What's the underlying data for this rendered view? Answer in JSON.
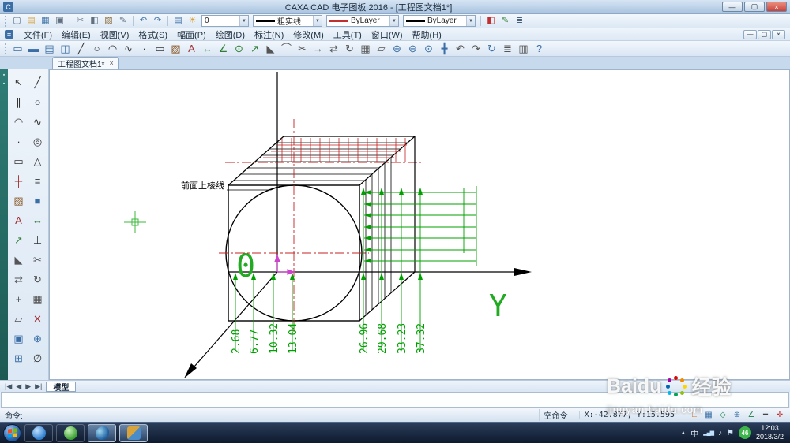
{
  "window": {
    "title": "CAXA CAD 电子图板 2016 - [工程图文档1*]",
    "controls": {
      "min": "—",
      "max": "▢",
      "close": "×"
    }
  },
  "menu": [
    {
      "name": "menu-file",
      "label": "文件(F)"
    },
    {
      "name": "menu-edit",
      "label": "编辑(E)"
    },
    {
      "name": "menu-view",
      "label": "视图(V)"
    },
    {
      "name": "menu-format",
      "label": "格式(S)"
    },
    {
      "name": "menu-sheet",
      "label": "幅面(P)"
    },
    {
      "name": "menu-draw",
      "label": "绘图(D)"
    },
    {
      "name": "menu-dimension",
      "label": "标注(N)"
    },
    {
      "name": "menu-modify",
      "label": "修改(M)"
    },
    {
      "name": "menu-tools",
      "label": "工具(T)"
    },
    {
      "name": "menu-window",
      "label": "窗口(W)"
    },
    {
      "name": "menu-help",
      "label": "帮助(H)"
    }
  ],
  "toolbars": {
    "std1": [
      {
        "name": "new-icon",
        "glyph": "▢",
        "color": "#55708c"
      },
      {
        "name": "open-icon",
        "glyph": "▤",
        "color": "#d9a33c"
      },
      {
        "name": "save-icon",
        "glyph": "▦",
        "color": "#3a6ea5"
      },
      {
        "name": "print-icon",
        "glyph": "▣",
        "color": "#607080"
      }
    ],
    "std2": [
      {
        "name": "cut-icon",
        "glyph": "✂",
        "color": "#607080"
      },
      {
        "name": "copy-icon",
        "glyph": "◧",
        "color": "#607080"
      },
      {
        "name": "paste-icon",
        "glyph": "▨",
        "color": "#8a6d3b"
      },
      {
        "name": "format-painter-icon",
        "glyph": "✎",
        "color": "#607080"
      }
    ],
    "std3": [
      {
        "name": "undo-icon",
        "glyph": "↶",
        "color": "#3a6ea5"
      },
      {
        "name": "redo-icon",
        "glyph": "↷",
        "color": "#3a6ea5"
      }
    ],
    "layer_pre": [
      {
        "name": "layer-manager-icon",
        "glyph": "▤",
        "color": "#3a6ea5"
      },
      {
        "name": "layer-state-icon",
        "glyph": "☀",
        "color": "#d9a33c"
      }
    ],
    "std4": [
      {
        "name": "color-palette-icon",
        "glyph": "◧",
        "color": "#c03030"
      },
      {
        "name": "match-properties-icon",
        "glyph": "✎",
        "color": "#2e7d32"
      },
      {
        "name": "options-menu-icon",
        "glyph": "≣",
        "color": "#49607a"
      }
    ],
    "row2": [
      {
        "name": "frame-icon",
        "glyph": "▭",
        "color": "#3a6ea5"
      },
      {
        "name": "title-block-icon",
        "glyph": "▬",
        "color": "#3a6ea5"
      },
      {
        "name": "table-icon",
        "glyph": "▤",
        "color": "#3a6ea5"
      },
      {
        "name": "view-icon",
        "glyph": "◫",
        "color": "#3a6ea5"
      },
      {
        "name": "line-icon",
        "glyph": "╱",
        "color": "#333333"
      },
      {
        "name": "circle-icon",
        "glyph": "○",
        "color": "#333333"
      },
      {
        "name": "arc-icon",
        "glyph": "◠",
        "color": "#333333"
      },
      {
        "name": "spline-icon",
        "glyph": "∿",
        "color": "#333333"
      },
      {
        "name": "point-icon",
        "glyph": "∙",
        "color": "#333333"
      },
      {
        "name": "rectangle-icon",
        "glyph": "▭",
        "color": "#333333"
      },
      {
        "name": "hatch-icon",
        "glyph": "▨",
        "color": "#8a5a2a"
      },
      {
        "name": "text-icon",
        "glyph": "A",
        "color": "#a03030"
      },
      {
        "name": "linear-dim-icon",
        "glyph": "↔",
        "color": "#2e7d32"
      },
      {
        "name": "angle-dim-icon",
        "glyph": "∠",
        "color": "#2e7d32"
      },
      {
        "name": "radial-dim-icon",
        "glyph": "⊙",
        "color": "#2e7d32"
      },
      {
        "name": "leader-icon",
        "glyph": "↗",
        "color": "#2e7d32"
      },
      {
        "name": "chamfer-icon",
        "glyph": "◣",
        "color": "#555555"
      },
      {
        "name": "fillet-icon",
        "glyph": "⌒",
        "color": "#555555"
      },
      {
        "name": "trim-icon",
        "glyph": "✂",
        "color": "#555555"
      },
      {
        "name": "extend-icon",
        "glyph": "→",
        "color": "#555555"
      },
      {
        "name": "mirror-icon",
        "glyph": "⇄",
        "color": "#555555"
      },
      {
        "name": "rotate-icon",
        "glyph": "↻",
        "color": "#555555"
      },
      {
        "name": "array-icon",
        "glyph": "▦",
        "color": "#555555"
      },
      {
        "name": "scale-icon",
        "glyph": "▱",
        "color": "#555555"
      },
      {
        "name": "zoom-in-icon",
        "glyph": "⊕",
        "color": "#3a6ea5"
      },
      {
        "name": "zoom-out-icon",
        "glyph": "⊖",
        "color": "#3a6ea5"
      },
      {
        "name": "zoom-all-icon",
        "glyph": "⊙",
        "color": "#3a6ea5"
      },
      {
        "name": "pan-icon",
        "glyph": "╋",
        "color": "#3a6ea5"
      },
      {
        "name": "prev-view-icon",
        "glyph": "↶",
        "color": "#555555"
      },
      {
        "name": "next-view-icon",
        "glyph": "↷",
        "color": "#555555"
      },
      {
        "name": "redraw-icon",
        "glyph": "↻",
        "color": "#3a6ea5"
      },
      {
        "name": "layer-list-icon",
        "glyph": "≣",
        "color": "#555555"
      },
      {
        "name": "properties-icon",
        "glyph": "▥",
        "color": "#555555"
      },
      {
        "name": "help-icon",
        "glyph": "?",
        "color": "#3a6ea5"
      }
    ],
    "left": [
      {
        "name": "select-icon",
        "glyph": "↖",
        "color": "#333333"
      },
      {
        "name": "line-tool-icon",
        "glyph": "╱",
        "color": "#333333"
      },
      {
        "name": "parallel-line-icon",
        "glyph": "∥",
        "color": "#333333"
      },
      {
        "name": "circle-tool-icon",
        "glyph": "○",
        "color": "#333333"
      },
      {
        "name": "arc-tool-icon",
        "glyph": "◠",
        "color": "#333333"
      },
      {
        "name": "spline-tool-icon",
        "glyph": "∿",
        "color": "#333333"
      },
      {
        "name": "point-tool-icon",
        "glyph": "∙",
        "color": "#333333"
      },
      {
        "name": "ellipse-tool-icon",
        "glyph": "◎",
        "color": "#333333"
      },
      {
        "name": "rectangle-tool-icon",
        "glyph": "▭",
        "color": "#333333"
      },
      {
        "name": "polygon-tool-icon",
        "glyph": "△",
        "color": "#333333"
      },
      {
        "name": "centerline-icon",
        "glyph": "┼",
        "color": "#a03030"
      },
      {
        "name": "offset-icon",
        "glyph": "≡",
        "color": "#333333"
      },
      {
        "name": "hatch-tool-icon",
        "glyph": "▨",
        "color": "#8a5a2a"
      },
      {
        "name": "fill-icon",
        "glyph": "■",
        "color": "#3a6ea5"
      },
      {
        "name": "text-tool-icon",
        "glyph": "A",
        "color": "#a03030"
      },
      {
        "name": "dimension-tool-icon",
        "glyph": "↔",
        "color": "#2e7d32"
      },
      {
        "name": "leader-tool-icon",
        "glyph": "↗",
        "color": "#2e7d32"
      },
      {
        "name": "datum-icon",
        "glyph": "⊥",
        "color": "#333333"
      },
      {
        "name": "chamfer-tool-icon",
        "glyph": "◣",
        "color": "#555555"
      },
      {
        "name": "trim-tool-icon",
        "glyph": "✂",
        "color": "#555555"
      },
      {
        "name": "mirror-tool-icon",
        "glyph": "⇄",
        "color": "#555555"
      },
      {
        "name": "rotate-tool-icon",
        "glyph": "↻",
        "color": "#555555"
      },
      {
        "name": "move-tool-icon",
        "glyph": "+",
        "color": "#555555"
      },
      {
        "name": "array-tool-icon",
        "glyph": "▦",
        "color": "#555555"
      },
      {
        "name": "scale-tool-icon",
        "glyph": "▱",
        "color": "#555555"
      },
      {
        "name": "erase-icon",
        "glyph": "✕",
        "color": "#a03030"
      },
      {
        "name": "block-icon",
        "glyph": "▣",
        "color": "#3a6ea5"
      },
      {
        "name": "zoom-tool-icon",
        "glyph": "⊕",
        "color": "#3a6ea5"
      },
      {
        "name": "pan-tool-icon",
        "glyph": "⊞",
        "color": "#3a6ea5"
      },
      {
        "name": "measure-icon",
        "glyph": "∅",
        "color": "#333333"
      }
    ]
  },
  "combos": {
    "layer": "0",
    "linetype": "粗实线",
    "color": "ByLayer",
    "width": "ByLayer",
    "dropdown_arrow": "▼"
  },
  "doc_tab": {
    "label": "工程图文档1*",
    "close": "×"
  },
  "model_bar": {
    "nav": [
      "|◀",
      "◀",
      "▶",
      "▶|"
    ],
    "tab": "模型"
  },
  "statusbar": {
    "prompt": "命令:",
    "mode": "空命令",
    "coords": "X:-42.877, Y:15.595",
    "icons": [
      {
        "name": "ortho-toggle-icon",
        "glyph": "∟",
        "color": "#d07020"
      },
      {
        "name": "grid-toggle-icon",
        "glyph": "▦",
        "color": "#3a6ea5"
      },
      {
        "name": "snap-toggle-icon",
        "glyph": "◇",
        "color": "#2e8b57"
      },
      {
        "name": "osnap-toggle-icon",
        "glyph": "⊕",
        "color": "#3a6ea5"
      },
      {
        "name": "polar-toggle-icon",
        "glyph": "∠",
        "color": "#2e8b57"
      },
      {
        "name": "lineweight-toggle-icon",
        "glyph": "━",
        "color": "#444444"
      },
      {
        "name": "dyninput-toggle-icon",
        "glyph": "✛",
        "color": "#c03030"
      }
    ]
  },
  "taskbar": {
    "tray": {
      "hidden": "▲",
      "lang": "中",
      "net": "▂▄▆",
      "vol": "♪",
      "flag": "⚑"
    },
    "badge": "46",
    "time": "12:03",
    "date": "2018/3/2"
  },
  "watermark": {
    "brand": "Baidu",
    "brand_cn": "经验",
    "url": "jingyan.baidu.com"
  },
  "canvas": {
    "edge_label": "前面上棱线",
    "origin_label": "0",
    "axis_label": "Y",
    "dims": [
      "2.68",
      "6.77",
      "10.32",
      "13.04",
      "26.96",
      "29.68",
      "33.23",
      "37.32"
    ]
  }
}
